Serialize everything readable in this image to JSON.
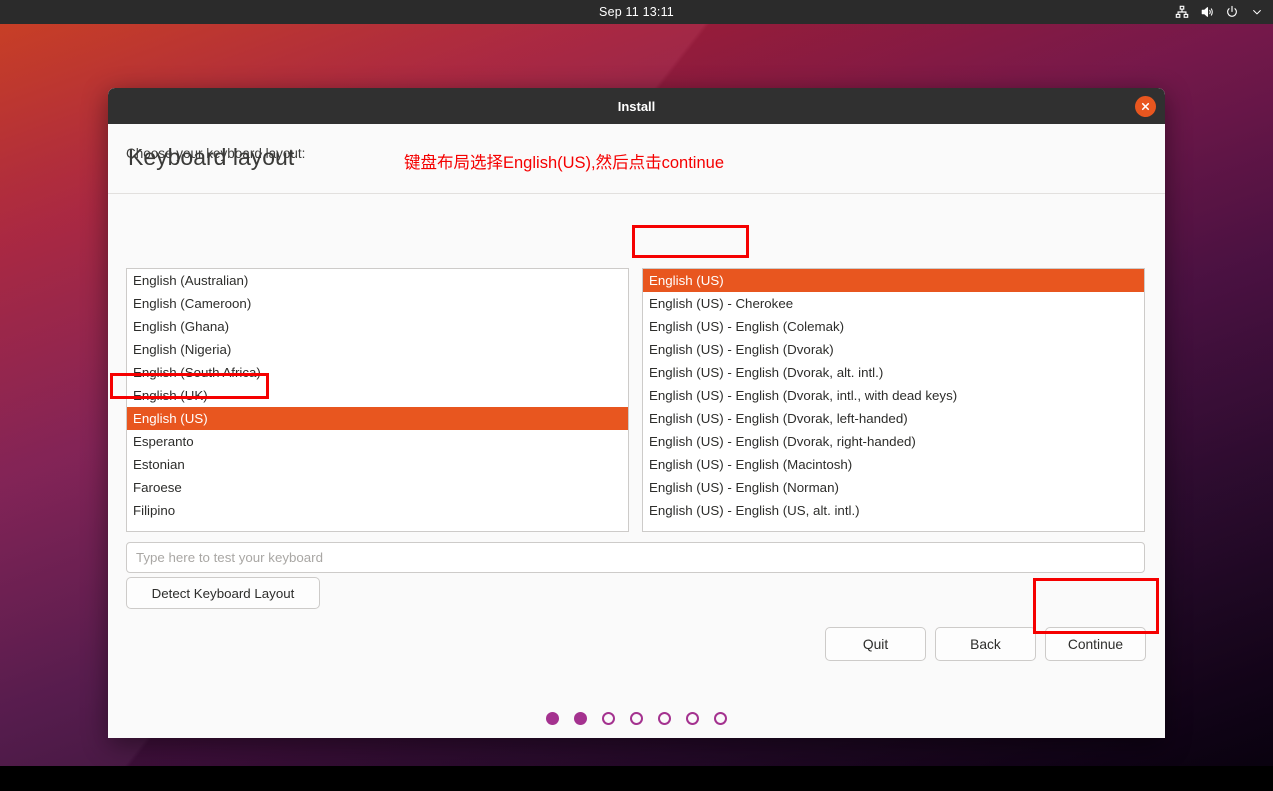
{
  "topbar": {
    "clock": "Sep 11 13:11",
    "indicators": [
      {
        "name": "network-icon",
        "label": "network"
      },
      {
        "name": "volume-icon",
        "label": "volume"
      },
      {
        "name": "power-icon",
        "label": "power"
      },
      {
        "name": "chevron-down-icon",
        "label": "system menu"
      }
    ]
  },
  "window": {
    "title": "Install",
    "close_label": "×"
  },
  "page": {
    "title": "Keyboard layout",
    "annotation": "键盘布局选择English(US),然后点击continue",
    "choose_label": "Choose your keyboard layout:"
  },
  "layout_list": {
    "items": [
      "English (Australian)",
      "English (Cameroon)",
      "English (Ghana)",
      "English (Nigeria)",
      "English (South Africa)",
      "English (UK)",
      "English (US)",
      "Esperanto",
      "Estonian",
      "Faroese",
      "Filipino"
    ],
    "selected_index": 6
  },
  "variant_list": {
    "items": [
      "English (US)",
      "English (US) - Cherokee",
      "English (US) - English (Colemak)",
      "English (US) - English (Dvorak)",
      "English (US) - English (Dvorak, alt. intl.)",
      "English (US) - English (Dvorak, intl., with dead keys)",
      "English (US) - English (Dvorak, left-handed)",
      "English (US) - English (Dvorak, right-handed)",
      "English (US) - English (Macintosh)",
      "English (US) - English (Norman)",
      "English (US) - English (US, alt. intl.)"
    ],
    "selected_index": 0
  },
  "test_field": {
    "placeholder": "Type here to test your keyboard",
    "value": ""
  },
  "buttons": {
    "detect": "Detect Keyboard Layout",
    "quit": "Quit",
    "back": "Back",
    "continue": "Continue"
  },
  "progress": {
    "total_dots": 7,
    "filled_dots": 2
  },
  "colors": {
    "selection_orange": "#e8561f",
    "annotation_red": "#f50000",
    "progress_purple": "#a4328f",
    "titlebar_dark": "#303030"
  }
}
